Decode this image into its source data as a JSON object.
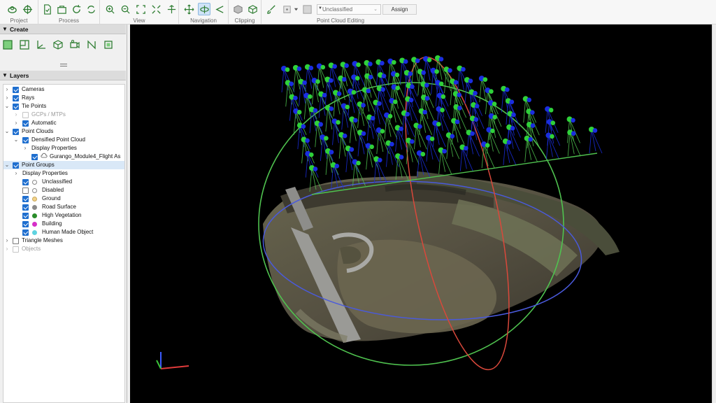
{
  "toolbar": {
    "groups": [
      {
        "label": "Project"
      },
      {
        "label": "Process"
      },
      {
        "label": "View"
      },
      {
        "label": "Navigation"
      },
      {
        "label": "Clipping"
      },
      {
        "label": "Point Cloud Editing"
      }
    ],
    "class_select_value": "Unclassified",
    "assign_label": "Assign",
    "accent_color": "#2e7d32"
  },
  "left_panel": {
    "create_header": "Create",
    "layers_header": "Layers",
    "tree": [
      {
        "label": "Cameras",
        "checked": true
      },
      {
        "label": "Rays",
        "checked": true
      },
      {
        "label": "Tie Points",
        "checked": true
      },
      {
        "label": "GCPs / MTPs",
        "checked": false,
        "disabled": true
      },
      {
        "label": "Automatic",
        "checked": true
      },
      {
        "label": "Point Clouds",
        "checked": true
      },
      {
        "label": "Densified Point Cloud",
        "checked": true
      },
      {
        "label": "Display Properties"
      },
      {
        "label": "Gurango_Module4_Flight As",
        "checked": true
      },
      {
        "label": "Point Groups",
        "checked": true
      },
      {
        "label": "Display Properties"
      },
      {
        "label": "Unclassified",
        "checked": true,
        "color": "#ffffff"
      },
      {
        "label": "Disabled",
        "checked": false,
        "color": "#ffffff"
      },
      {
        "label": "Ground",
        "checked": true,
        "color": "#f2d28a"
      },
      {
        "label": "Road Surface",
        "checked": true,
        "color": "#8a8a8a"
      },
      {
        "label": "High Vegetation",
        "checked": true,
        "color": "#2a8c2a"
      },
      {
        "label": "Building",
        "checked": true,
        "color": "#d62fc8"
      },
      {
        "label": "Human Made Object",
        "checked": true,
        "color": "#5fd3e0"
      },
      {
        "label": "Triangle Meshes",
        "checked": false
      },
      {
        "label": "Objects",
        "checked": false,
        "disabled": true
      }
    ]
  },
  "viewport": {
    "colors": {
      "background": "#000000",
      "camera_green": "#2fd13a",
      "camera_blue": "#1a2ee0",
      "ellipse_green": "#4fc24f",
      "ellipse_blue": "#4a5adc",
      "ellipse_red": "#d9483b"
    }
  }
}
